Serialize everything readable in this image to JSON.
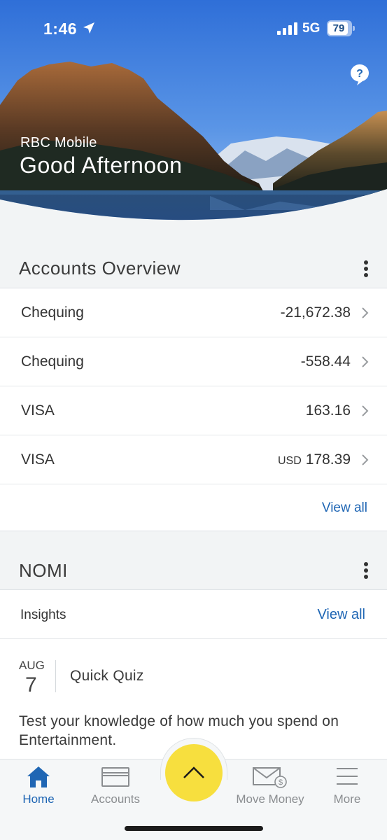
{
  "status_bar": {
    "time": "1:46",
    "network": "5G",
    "battery": "79"
  },
  "hero": {
    "app_name": "RBC Mobile",
    "greeting": "Good Afternoon"
  },
  "accounts_overview": {
    "title": "Accounts Overview",
    "accounts": [
      {
        "name": "Chequing",
        "currency": "",
        "amount": "-21,672.38"
      },
      {
        "name": "Chequing",
        "currency": "",
        "amount": "-558.44"
      },
      {
        "name": "VISA",
        "currency": "",
        "amount": "163.16"
      },
      {
        "name": "VISA",
        "currency": "USD",
        "amount": "178.39"
      }
    ],
    "view_all": "View all"
  },
  "nomi": {
    "title": "NOMI",
    "insights_label": "Insights",
    "view_all": "View all",
    "insight": {
      "month": "AUG",
      "day": "7",
      "title": "Quick Quiz",
      "description": "Test your knowledge of how much you spend on Entertainment."
    }
  },
  "bottom_nav": {
    "items": [
      {
        "label": "Home",
        "icon": "home-icon",
        "active": true
      },
      {
        "label": "Accounts",
        "icon": "card-icon",
        "active": false
      },
      {
        "label": "Move Money",
        "icon": "envelope-dollar-icon",
        "active": false
      },
      {
        "label": "More",
        "icon": "menu-icon",
        "active": false
      }
    ],
    "fab_icon": "chevron-up-icon"
  },
  "colors": {
    "accent_blue": "#1f66b4",
    "fab_yellow": "#f7df3e",
    "background": "#f2f4f5"
  }
}
